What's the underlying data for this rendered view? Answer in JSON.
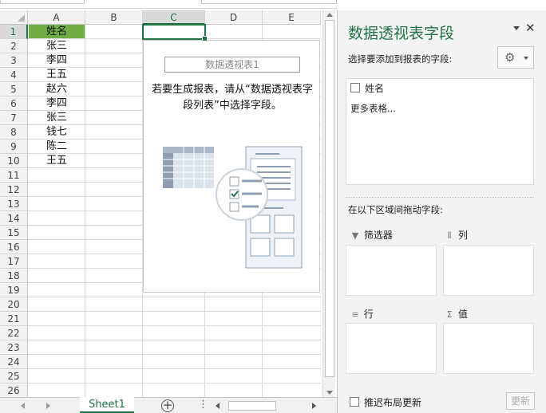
{
  "columns": [
    "A",
    "B",
    "C",
    "D",
    "E"
  ],
  "rows": [
    "1",
    "2",
    "3",
    "4",
    "5",
    "6",
    "7",
    "8",
    "9",
    "10",
    "11",
    "12",
    "13",
    "14",
    "15",
    "16",
    "17",
    "18",
    "19",
    "20",
    "21",
    "22",
    "23",
    "24",
    "25",
    "26"
  ],
  "column_a_values": [
    "姓名",
    "张三",
    "李四",
    "王五",
    "赵六",
    "李四",
    "张三",
    "钱七",
    "陈二",
    "王五"
  ],
  "pivot": {
    "title": "数据透视表1",
    "message": "若要生成报表，请从“数据透视表字段列表”中选择字段。"
  },
  "sheet_tab": "Sheet1",
  "add_sheet_symbol": "+",
  "more_symbol": "⋮",
  "pane": {
    "title": "数据透视表字段",
    "close_symbol": "✕",
    "choose_label": "选择要添加到报表的字段:",
    "fields": [
      "姓名"
    ],
    "more_tables": "更多表格...",
    "drag_label": "在以下区域间拖动字段:",
    "filter_label": "筛选器",
    "column_label": "列",
    "row_label": "行",
    "value_label": "值",
    "defer_label": "推迟布局更新",
    "update_label": "更新"
  },
  "colors": {
    "accent": "#217346",
    "header_cell_fill": "#70ad47"
  },
  "icons": [
    "gear-icon",
    "filter-icon",
    "columns-icon",
    "rows-icon",
    "sigma-icon",
    "close-icon",
    "dropdown-icon",
    "add-sheet-icon"
  ]
}
